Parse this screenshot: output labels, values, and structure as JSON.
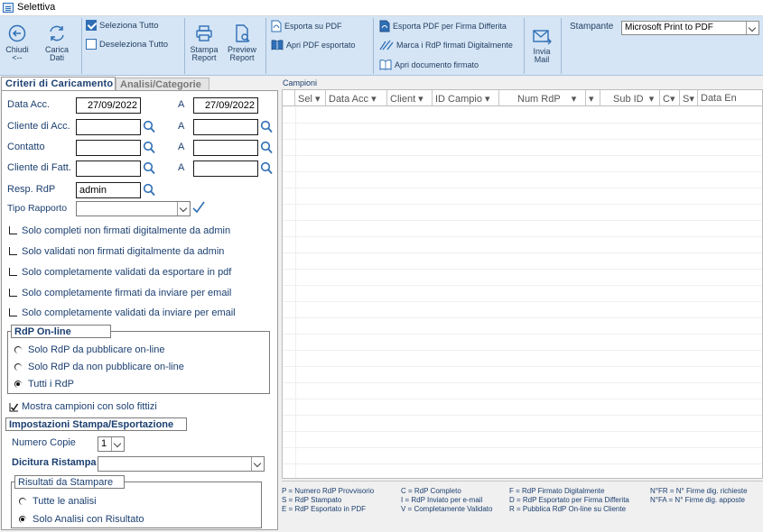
{
  "window": {
    "title": "Selettiva"
  },
  "ribbon": {
    "chiudi": "Chiudi\n<--",
    "carica": "Carica\nDati",
    "seleziona_tutto": "Seleziona Tutto",
    "deseleziona_tutto": "Deseleziona Tutto",
    "stampa_report": "Stampa\nReport",
    "preview_report": "Preview\nReport",
    "esporta_pdf": "Esporta su PDF",
    "apri_pdf": "Apri PDF esportato",
    "esporta_firma": "Esporta PDF per Firma Differita",
    "marca_firmati": "Marca i RdP firmati Digitalmente",
    "apri_firmato": "Apri documento firmato",
    "invia_mail": "Invia\nMail",
    "stampante_label": "Stampante",
    "stampante_value": "Microsoft Print to PDF"
  },
  "tabs": {
    "criteri": "Criteri di Caricamento",
    "analisi": "Analisi/Categorie"
  },
  "criteri": {
    "data_acc_label": "Data Acc.",
    "data_acc_from": "27/09/2022",
    "a_label": "A",
    "data_acc_to": "27/09/2022",
    "cliente_acc_label": "Cliente di Acc.",
    "contatto_label": "Contatto",
    "cliente_fatt_label": "Cliente di Fatt.",
    "resp_label": "Resp. RdP",
    "resp_value": "admin",
    "tipo_rapporto_label": "Tipo Rapporto",
    "filters": [
      "Solo completi non firmati digitalmente da admin",
      "Solo validati non firmati digitalmente da admin",
      "Solo completamente validati da esportare in pdf",
      "Solo completamente firmati da inviare per email",
      "Solo completamente validati da inviare per email"
    ],
    "online_title": "RdP On-line",
    "online_options": [
      "Solo RdP da pubblicare on-line",
      "Solo RdP da non pubblicare on-line",
      "Tutti i RdP"
    ],
    "online_selected": 2,
    "mostra_fittizi": "Mostra campioni con solo fittizi",
    "stampa_title": "Impostazioni Stampa/Esportazione",
    "numero_copie_label": "Numero Copie",
    "numero_copie_value": "1",
    "dicitura_label": "Dicitura Ristampa",
    "risultati_title": "Risultati da Stampare",
    "risultati_options": [
      "Tutte le analisi",
      "Solo Analisi con Risultato"
    ],
    "risultati_selected": 1
  },
  "campioni": {
    "label": "Campioni",
    "columns": [
      "Sel",
      "Data Acc",
      "Client",
      "ID Campio",
      "Num RdP",
      "",
      "Sub ID",
      "C",
      "S",
      "Data En"
    ]
  },
  "legend": {
    "col1": [
      "P = Numero RdP Provvisorio",
      "S = RdP Stampato",
      "E = RdP Esportato in PDF"
    ],
    "col2": [
      "C = RdP Completo",
      "I = RdP Inviato per e-mail",
      "V = Completamente Validato"
    ],
    "col3": [
      "F = RdP Firmato Digitalmente",
      "D = RdP Esportato per Firma Differita",
      "R = Pubblica RdP On-line su Cliente"
    ],
    "col4": [
      "N°FR = N° Firme dig. richieste",
      "N°FA = N° Firme dig. apposte"
    ]
  },
  "colors": {
    "ribbon_bg": "#d5e5f5",
    "accent": "#2f6fb5",
    "label_text": "#1b3f70"
  }
}
